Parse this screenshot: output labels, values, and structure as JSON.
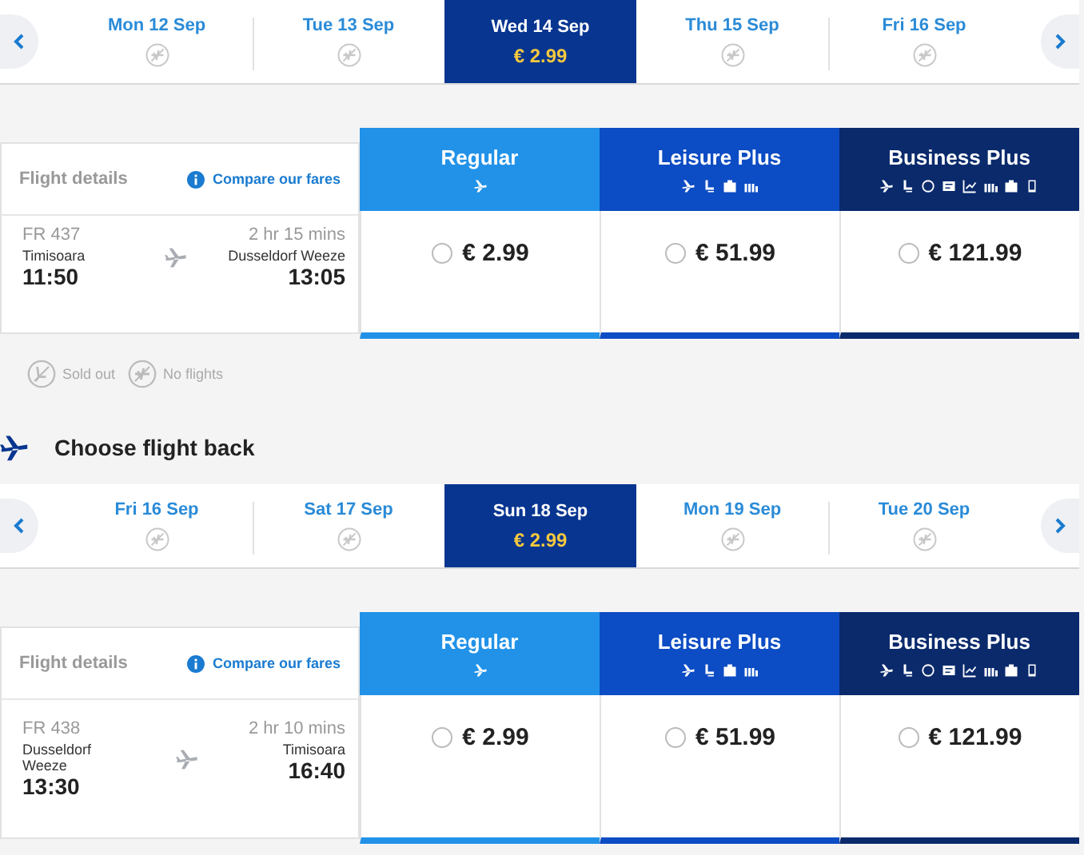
{
  "outbound": {
    "dates": [
      {
        "label": "Mon 12 Sep",
        "selected": false
      },
      {
        "label": "Tue 13 Sep",
        "selected": false
      },
      {
        "label": "Wed 14 Sep",
        "selected": true,
        "price": "€ 2.99"
      },
      {
        "label": "Thu 15 Sep",
        "selected": false
      },
      {
        "label": "Fri 16 Sep",
        "selected": false
      }
    ],
    "table": {
      "details_title": "Flight details",
      "compare_link": "Compare our fares",
      "flight": {
        "number": "FR 437",
        "origin": "Timisoara",
        "departure": "11:50",
        "duration": "2 hr 15 mins",
        "destination": "Dusseldorf Weeze",
        "arrival": "13:05"
      },
      "fares": [
        {
          "name": "Regular",
          "kind": "regular",
          "color": "#2192e8",
          "price": "€ 2.99",
          "selected": false
        },
        {
          "name": "Leisure Plus",
          "kind": "leisure",
          "color": "#0c4cc4",
          "price": "€ 51.99",
          "selected": false
        },
        {
          "name": "Business Plus",
          "kind": "business",
          "color": "#0a2a6c",
          "price": "€ 121.99",
          "selected": false
        }
      ]
    }
  },
  "legend": [
    {
      "label": "Sold out",
      "kind": "sold_out"
    },
    {
      "label": "No flights",
      "kind": "no_flights"
    }
  ],
  "return": {
    "heading": "Choose flight back",
    "dates": [
      {
        "label": "Fri 16 Sep",
        "selected": false
      },
      {
        "label": "Sat 17 Sep",
        "selected": false
      },
      {
        "label": "Sun 18 Sep",
        "selected": true,
        "price": "€ 2.99"
      },
      {
        "label": "Mon 19 Sep",
        "selected": false
      },
      {
        "label": "Tue 20 Sep",
        "selected": false
      }
    ],
    "table": {
      "details_title": "Flight details",
      "compare_link": "Compare our fares",
      "flight": {
        "number": "FR 438",
        "origin": "Dusseldorf Weeze",
        "departure": "13:30",
        "duration": "2 hr 10 mins",
        "destination": "Timisoara",
        "arrival": "16:40"
      },
      "fares": [
        {
          "name": "Regular",
          "kind": "regular",
          "color": "#2192e8",
          "price": "€ 2.99",
          "selected": false
        },
        {
          "name": "Leisure Plus",
          "kind": "leisure",
          "color": "#0c4cc4",
          "price": "€ 51.99",
          "selected": false
        },
        {
          "name": "Business Plus",
          "kind": "business",
          "color": "#0a2a6c",
          "price": "€ 121.99",
          "selected": false
        }
      ]
    }
  }
}
